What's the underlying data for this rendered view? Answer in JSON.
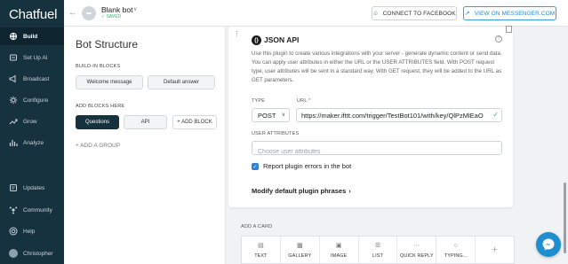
{
  "app": {
    "logo": "Chatfuel"
  },
  "sidebar": {
    "items": [
      {
        "label": "Build",
        "icon": "build-icon",
        "active": true
      },
      {
        "label": "Set Up AI",
        "icon": "ai-icon"
      },
      {
        "label": "Broadcast",
        "icon": "broadcast-icon"
      },
      {
        "label": "Configure",
        "icon": "gear-icon"
      },
      {
        "label": "Grow",
        "icon": "grow-icon"
      },
      {
        "label": "Analyze",
        "icon": "analyze-icon"
      },
      {
        "label": "Updates",
        "icon": "updates-icon"
      },
      {
        "label": "Community",
        "icon": "community-icon"
      },
      {
        "label": "Help",
        "icon": "help-icon"
      },
      {
        "label": "Christopher",
        "icon": "avatar"
      }
    ]
  },
  "topbar": {
    "bot_name": "Blank bot",
    "bot_status": "✓ SAVED",
    "connect_facebook": "CONNECT TO FACEBOOK",
    "view_messenger": "VIEW ON MESSENGER.COM"
  },
  "structure": {
    "title": "Bot Structure",
    "builtin_label": "BUILD-IN BLOCKS",
    "builtin_blocks": [
      "Welcome message",
      "Default answer"
    ],
    "add_blocks_label": "ADD BLOCKS HERE",
    "blocks": [
      "Questions",
      "API"
    ],
    "add_block": "+ ADD BLOCK",
    "add_group": "+  ADD A GROUP"
  },
  "plugin": {
    "title": "JSON API",
    "description": "Use this plugin to create various integrations with your server - generate dynamic content or send data. You can apply user attributes in either the URL or the USER ATTRIBUTES field. With POST request type, user attributes will be sent in a standard way. With GET request, they will be added to the URL as GET parameters.",
    "type_label": "TYPE",
    "type_value": "POST",
    "url_label": "URL",
    "url_required": "*",
    "url_value": "https://maker.ifttt.com/trigger/TestBot101/with/key/QlPzMlEaO",
    "attrs_label": "USER ATTRIBUTES",
    "attrs_placeholder": "Choose user attributes",
    "report_errors_label": "Report plugin errors in the bot",
    "report_errors_checked": true,
    "modify_phrases": "Modify default plugin phrases"
  },
  "add_card": {
    "label": "ADD A CARD",
    "cards": [
      "TEXT",
      "GALLERY",
      "IMAGE",
      "LIST",
      "QUICK REPLY",
      "TYPING..."
    ],
    "more": "+"
  },
  "colors": {
    "sidebar": "#17323f",
    "accent": "#1f8ecf",
    "saved": "#3cb371"
  }
}
